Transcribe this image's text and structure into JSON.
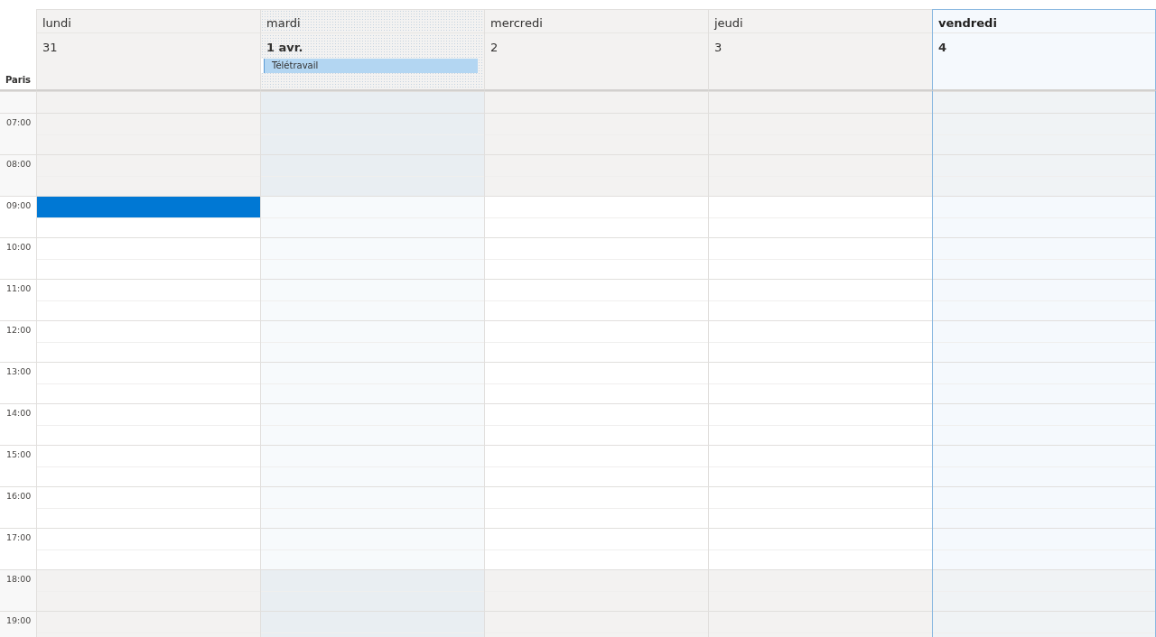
{
  "timezone": "Paris",
  "days": [
    {
      "name": "lundi",
      "date": "31",
      "selected": false,
      "emphasized": false,
      "hatched": false
    },
    {
      "name": "mardi",
      "date": "1 avr.",
      "selected": false,
      "emphasized": true,
      "hatched": true,
      "all_day": [
        {
          "title": "Télétravail",
          "color": "#b3d6f2"
        }
      ]
    },
    {
      "name": "mercredi",
      "date": "2",
      "selected": false,
      "emphasized": false,
      "hatched": false
    },
    {
      "name": "jeudi",
      "date": "3",
      "selected": false,
      "emphasized": false,
      "hatched": false
    },
    {
      "name": "vendredi",
      "date": "4",
      "selected": true,
      "emphasized": true,
      "hatched": false
    }
  ],
  "rows": [
    {
      "kind": "half",
      "working": false
    },
    {
      "kind": "hour",
      "label": "07:00",
      "working": false
    },
    {
      "kind": "hour",
      "label": "08:00",
      "working": false
    },
    {
      "kind": "hour",
      "label": "09:00",
      "working": true,
      "busy": [
        true,
        false,
        false,
        false,
        false
      ]
    },
    {
      "kind": "hour",
      "label": "10:00",
      "working": true
    },
    {
      "kind": "hour",
      "label": "11:00",
      "working": true
    },
    {
      "kind": "hour",
      "label": "12:00",
      "working": true
    },
    {
      "kind": "hour",
      "label": "13:00",
      "working": true
    },
    {
      "kind": "hour",
      "label": "14:00",
      "working": true
    },
    {
      "kind": "hour",
      "label": "15:00",
      "working": true
    },
    {
      "kind": "hour",
      "label": "16:00",
      "working": true
    },
    {
      "kind": "hour",
      "label": "17:00",
      "working": true
    },
    {
      "kind": "hour",
      "label": "18:00",
      "working": false
    },
    {
      "kind": "hour",
      "label": "19:00",
      "working": false
    }
  ]
}
